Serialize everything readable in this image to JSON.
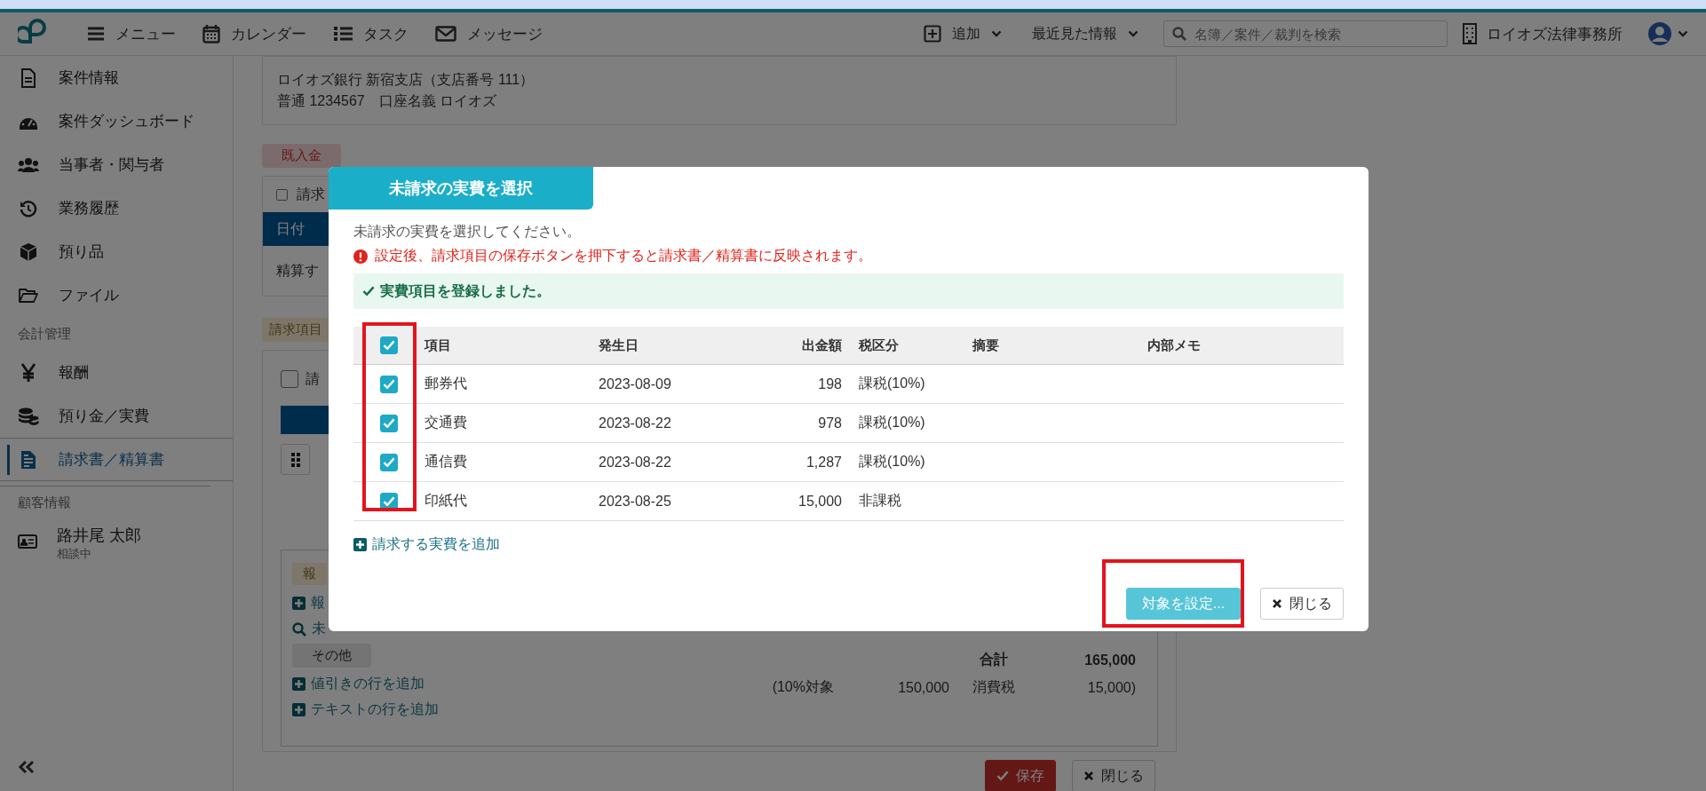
{
  "header": {
    "nav": [
      {
        "label": "メニュー"
      },
      {
        "label": "カレンダー"
      },
      {
        "label": "タスク"
      },
      {
        "label": "メッセージ"
      }
    ],
    "add": "追加",
    "recent": "最近見た情報",
    "search": {
      "placeholder": "名簿／案件／裁判を検索"
    },
    "office": "ロイオズ法律事務所"
  },
  "sidebar": {
    "items": [
      {
        "kind": "link",
        "label": "案件情報",
        "selected": false
      },
      {
        "kind": "link",
        "label": "案件ダッシュボード",
        "selected": false
      },
      {
        "kind": "link",
        "label": "当事者・関与者",
        "selected": false
      },
      {
        "kind": "link",
        "label": "業務履歴",
        "selected": false
      },
      {
        "kind": "link",
        "label": "預り品",
        "selected": false
      },
      {
        "kind": "link",
        "label": "ファイル",
        "selected": false
      },
      {
        "kind": "heading",
        "label": "会計管理"
      },
      {
        "kind": "link",
        "label": "報酬",
        "selected": false
      },
      {
        "kind": "link",
        "label": "預り金／実費",
        "selected": false
      },
      {
        "kind": "link",
        "label": "請求書／精算書",
        "selected": true
      },
      {
        "kind": "heading",
        "label": "顧客情報"
      },
      {
        "kind": "client",
        "label": "路井尾 太郎",
        "sub": "相談中"
      }
    ]
  },
  "bank": {
    "lines": [
      "ロイオズ銀行 新宿支店（支店番号 111）",
      "普通 1234567　口座名義 ロイオズ"
    ]
  },
  "received": {
    "badge": "既入金",
    "checkbox_label": "請求",
    "checked": false,
    "header": "日付",
    "row": "精算す"
  },
  "billing": {
    "badge": "請求項目",
    "checkbox_label": "請",
    "checked": false,
    "category": "報",
    "links": [
      {
        "kind": "add",
        "label": "報"
      },
      {
        "kind": "search",
        "label": "未"
      }
    ],
    "other_badge": "その他",
    "add_links": [
      "値引きの行を追加",
      "テキストの行を追加"
    ],
    "totals": {
      "total_label": "合計",
      "total": "165,000",
      "base_label": "(10%対象",
      "base": "150,000",
      "tax_label": "消費税",
      "tax": "15,000)"
    }
  },
  "footer_buttons": [
    {
      "kind": "save",
      "label": "保存"
    },
    {
      "kind": "close",
      "label": "閉じる"
    }
  ],
  "dialog": {
    "title": "未請求の実費を選択",
    "description": "未請求の実費を選択してください。",
    "warning": "設定後、請求項目の保存ボタンを押下すると請求書／精算書に反映されます。",
    "success": "実費項目を登録しました。",
    "columns": [
      "項目",
      "発生日",
      "出金額",
      "税区分",
      "摘要",
      "内部メモ"
    ],
    "all_checked": true,
    "rows": [
      {
        "checked": true,
        "item": "郵券代",
        "date": "2023-08-09",
        "amount": "198",
        "tax": "課税(10%)"
      },
      {
        "checked": true,
        "item": "交通費",
        "date": "2023-08-22",
        "amount": "978",
        "tax": "課税(10%)"
      },
      {
        "checked": true,
        "item": "通信費",
        "date": "2023-08-22",
        "amount": "1,287",
        "tax": "課税(10%)"
      },
      {
        "checked": true,
        "item": "印紙代",
        "date": "2023-08-25",
        "amount": "15,000",
        "tax": "非課税"
      }
    ],
    "add_link": "請求する実費を追加",
    "buttons": [
      {
        "kind": "primary",
        "label": "対象を設定..."
      },
      {
        "kind": "close",
        "label": "閉じる"
      }
    ]
  }
}
